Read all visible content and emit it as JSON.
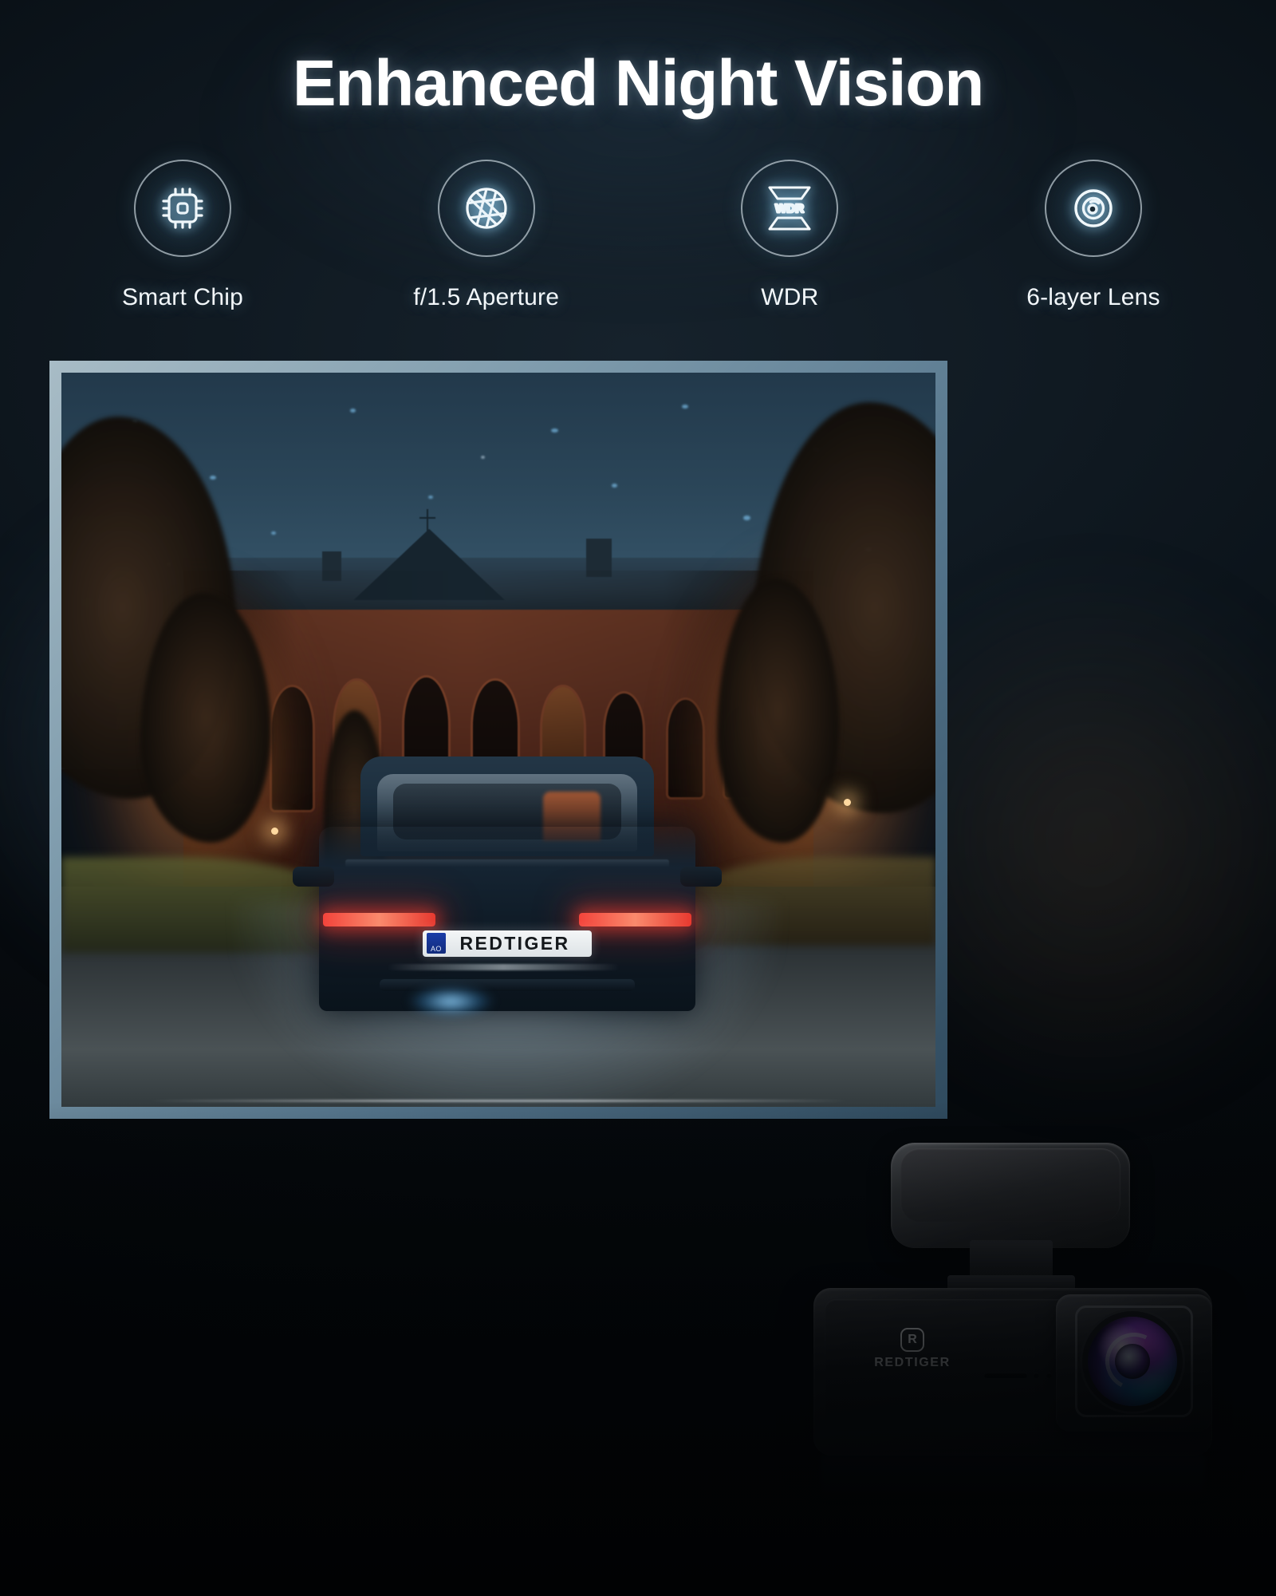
{
  "page": {
    "title": "Enhanced Night Vision",
    "background_color": "#050a0e",
    "accent_color": "#8fd3f4"
  },
  "features": [
    {
      "icon": "smart-chip-icon",
      "label": "Smart Chip"
    },
    {
      "icon": "aperture-icon",
      "label": "f/1.5 Aperture"
    },
    {
      "icon": "wdr-icon",
      "label": "WDR",
      "badge_text": "WDR"
    },
    {
      "icon": "lens-layers-icon",
      "label": "6-layer Lens"
    }
  ],
  "photo": {
    "name": "night-driving-scene",
    "frame_color": "#8aa5b5",
    "scene": {
      "time": "night",
      "sky_color": "#2d4354",
      "building": "brick gothic building with gabled roof and arched windows",
      "car": {
        "name": "dark blue sedan rear view",
        "license_plate": "REDTIGER",
        "license_plate_region_code": "AO",
        "taillight_color": "#ff4030",
        "headlight_glow_color": "#9ad6ff"
      },
      "road_surface": "asphalt with painted centre line",
      "ambient_light_color": "#c4703a"
    }
  },
  "product": {
    "name": "redtiger-dashcam",
    "brand": "REDTIGER",
    "brand_mark": "R",
    "mount": "magnetic-mount-puck",
    "lens": "iridescent-camera-lens",
    "lens_colors": [
      "#c552e8",
      "#2fd4e8",
      "#6a3fd0"
    ]
  }
}
